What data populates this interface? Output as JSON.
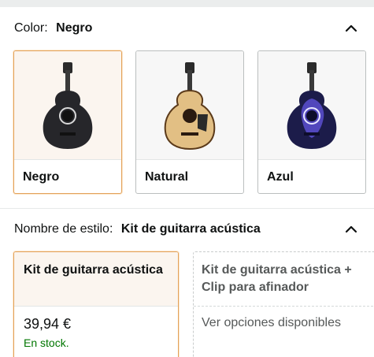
{
  "color_section": {
    "label": "Color:",
    "selected_value": "Negro",
    "collapse_icon": "chevron-up-icon",
    "options": [
      {
        "name": "Negro",
        "selected": true,
        "body_color": "#2a2a2e"
      },
      {
        "name": "Natural",
        "selected": false,
        "body_color": "#e2bf84"
      },
      {
        "name": "Azul",
        "selected": false,
        "body_color": "#3a3a9a"
      }
    ]
  },
  "style_section": {
    "label": "Nombre de estilo:",
    "selected_value": "Kit de guitarra acústica",
    "collapse_icon": "chevron-up-icon",
    "options": [
      {
        "title": "Kit de guitarra acústica",
        "price": "39,94 €",
        "availability": "En stock.",
        "selected": true
      },
      {
        "title": "Kit de guitarra acústica + Clip para afinador",
        "note": "Ver opciones disponibles",
        "selected": false
      }
    ]
  },
  "colors": {
    "selected_border": "#e3a25a",
    "in_stock": "#007600",
    "muted_text": "#565959"
  }
}
